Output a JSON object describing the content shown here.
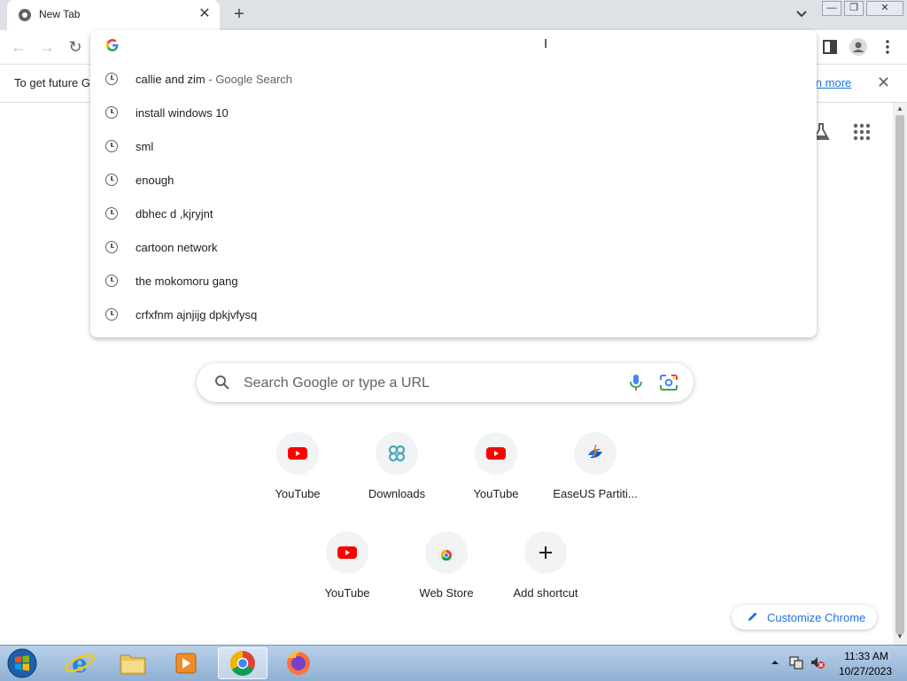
{
  "tab": {
    "title": "New Tab",
    "close_label": "✕",
    "new_tab_label": "+"
  },
  "window_controls": {
    "minimize": "—",
    "restore": "❐",
    "close": "✕"
  },
  "infobar": {
    "message": "To get future G",
    "link": "earn more",
    "close_label": "✕"
  },
  "suggestions": [
    {
      "text": "callie and zim",
      "suffix": " - Google Search"
    },
    {
      "text": "install windows 10",
      "suffix": ""
    },
    {
      "text": "sml",
      "suffix": ""
    },
    {
      "text": "enough",
      "suffix": ""
    },
    {
      "text": "dbhec d ,kjryjnt",
      "suffix": ""
    },
    {
      "text": "cartoon network",
      "suffix": ""
    },
    {
      "text": "the mokomoru gang",
      "suffix": ""
    },
    {
      "text": "crfxfnm ajnjijg dpkjvfysq",
      "suffix": ""
    }
  ],
  "search": {
    "placeholder": "Search Google or type a URL"
  },
  "shortcuts": [
    {
      "label": "YouTube",
      "icon": "youtube-icon"
    },
    {
      "label": "Downloads",
      "icon": "downloads-icon"
    },
    {
      "label": "YouTube",
      "icon": "youtube-icon"
    },
    {
      "label": "EaseUS Partiti...",
      "icon": "easeus-icon"
    },
    {
      "label": "YouTube",
      "icon": "youtube-icon"
    },
    {
      "label": "Web Store",
      "icon": "webstore-icon"
    },
    {
      "label": "Add shortcut",
      "icon": "plus-icon"
    }
  ],
  "customize": {
    "label": "Customize Chrome"
  },
  "taskbar": {
    "time": "11:33 AM",
    "date": "10/27/2023"
  },
  "colors": {
    "accent": "#1a73e8",
    "tabstrip": "#dee1e6",
    "youtube_red": "#ff0000"
  }
}
